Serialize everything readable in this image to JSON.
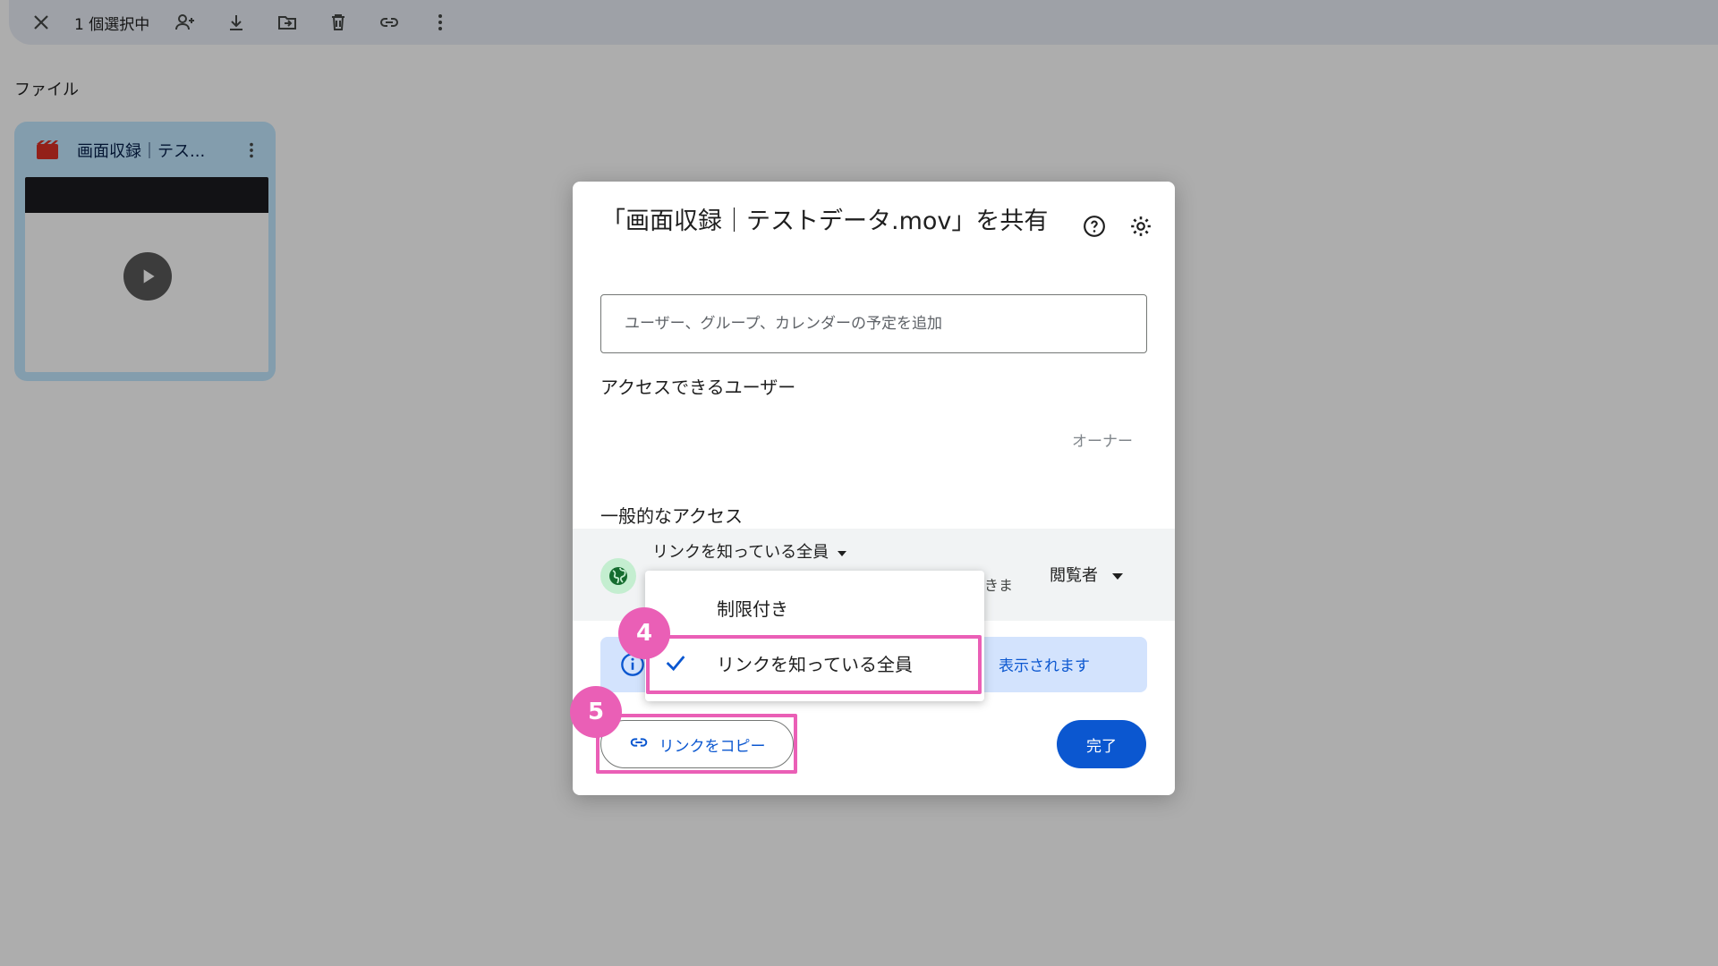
{
  "toolbar": {
    "selected_count": "1 個選択中",
    "icons": [
      "close-icon",
      "share-person-icon",
      "download-icon",
      "move-folder-icon",
      "trash-icon",
      "link-icon",
      "more-vert-icon"
    ]
  },
  "files": {
    "section_title": "ファイル",
    "items": [
      {
        "name": "画面収録｜テス...",
        "type_icon": "video-file-icon"
      }
    ]
  },
  "dialog": {
    "title": "「画面収録｜テストデータ.mov」を共有",
    "add_placeholder": "ユーザー、グループ、カレンダーの予定を追加",
    "people_title": "アクセスできるユーザー",
    "owner_label": "オーナー",
    "general_access_title": "一般的なアクセス",
    "access_value": "リンクを知っている全員",
    "access_desc_partial": "きま",
    "role_value": "閲覧者",
    "info_text_partial": "表示されます",
    "copy_link_label": "リンクをコピー",
    "done_label": "完了"
  },
  "menu": {
    "items": [
      {
        "label": "制限付き",
        "checked": false
      },
      {
        "label": "リンクを知っている全員",
        "checked": true
      }
    ]
  },
  "annotations": {
    "step4": "4",
    "step5": "5",
    "highlight_color": "#ea5fb6"
  },
  "colors": {
    "primary": "#0b57d0",
    "selection_bar": "#e9eef6",
    "file_card": "#c2e7ff",
    "globe_bg": "#c4eed0",
    "info_banner": "#d3e3fd"
  }
}
